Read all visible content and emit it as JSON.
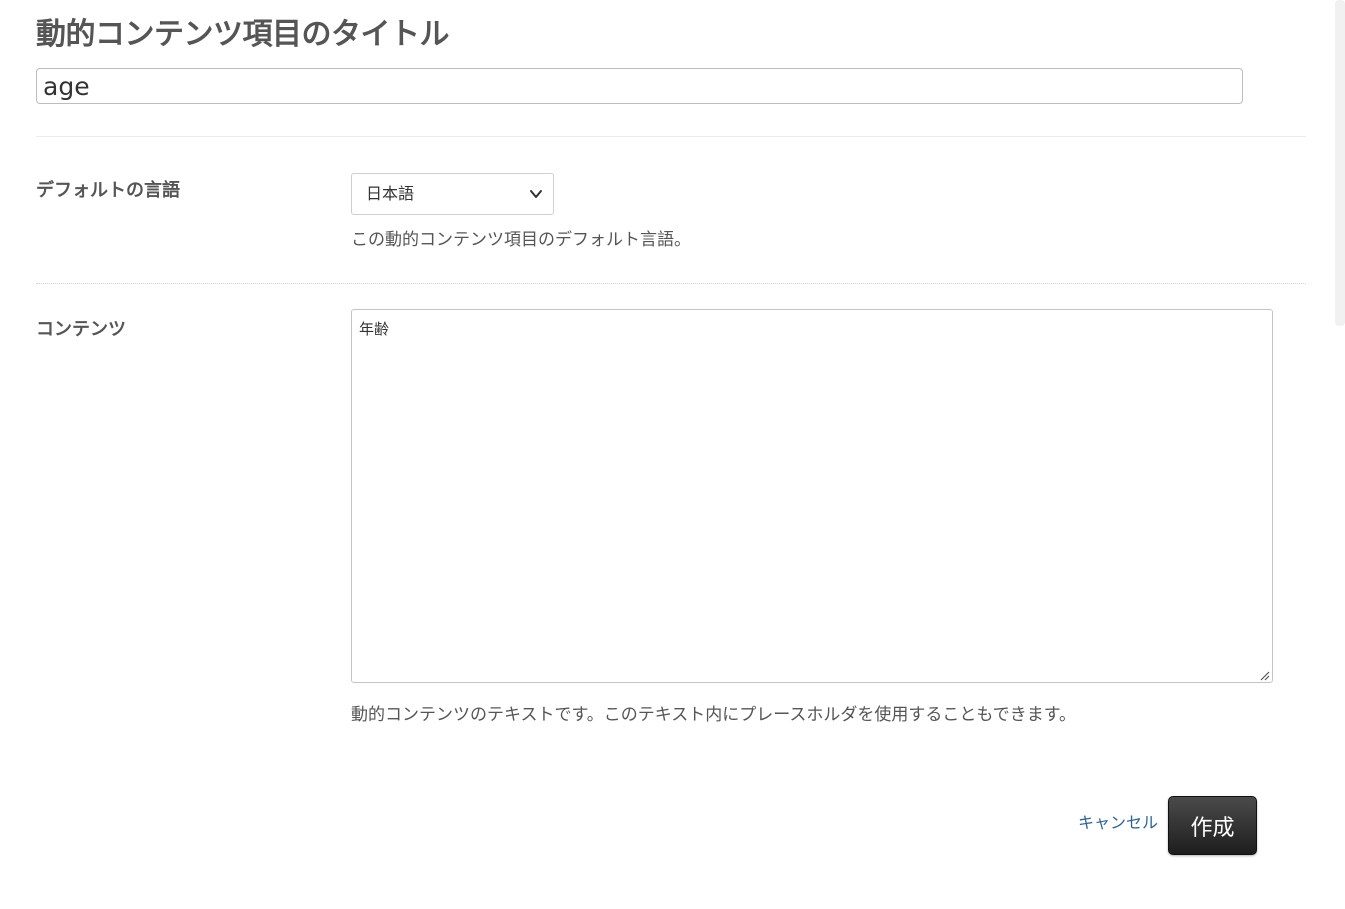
{
  "header": {
    "title": "動的コンテンツ項目のタイトル",
    "title_value": "age"
  },
  "language": {
    "label": "デフォルトの言語",
    "selected": "日本語",
    "help": "この動的コンテンツ項目のデフォルト言語。"
  },
  "content": {
    "label": "コンテンツ",
    "value": "年齢",
    "help": "動的コンテンツのテキストです。このテキスト内にプレースホルダを使用することもできます。"
  },
  "actions": {
    "cancel_label": "キャンセル",
    "create_label": "作成"
  },
  "colors": {
    "link": "#2a6496",
    "primary_button": "#2b2b2b",
    "text": "#555555"
  },
  "icons": {
    "select_caret": "chevron-down-icon",
    "textarea_resize": "resize-handle-icon"
  }
}
